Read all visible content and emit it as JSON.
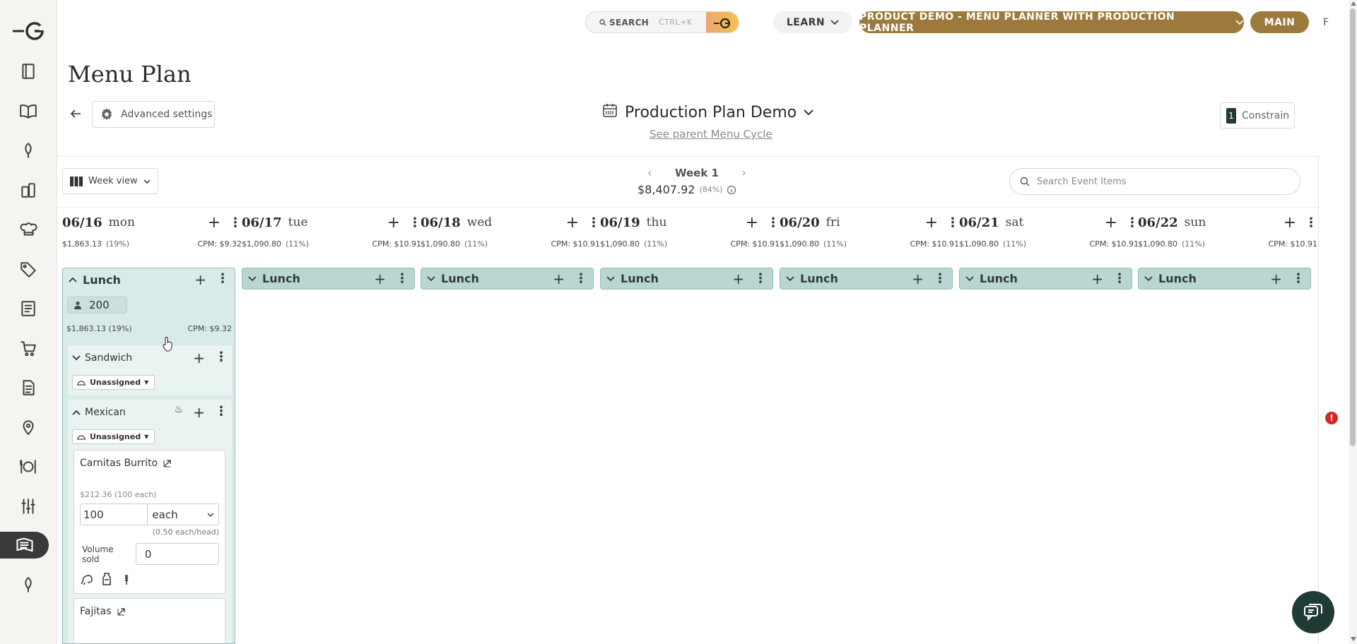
{
  "topbar": {
    "search_label": "SEARCH",
    "search_shortcut": "CTRL+K",
    "learn_label": "LEARN",
    "demo_label": "PRODUCT DEMO - MENU PLANNER WITH PRODUCTION PLANNER",
    "main_label": "MAIN",
    "user_initial": "F"
  },
  "sidebar": {
    "icons": [
      "logo-icon",
      "recipes-icon",
      "book-icon",
      "ingredient-icon",
      "products-icon",
      "chef-icon",
      "tag-icon",
      "checklist-icon",
      "cart-icon",
      "document-icon",
      "location-icon",
      "dining-icon",
      "sliders-icon",
      "menu-planner-icon",
      "leaf-icon"
    ],
    "active": "menu-planner-icon"
  },
  "page": {
    "title": "Menu Plan",
    "advanced_settings": "Advanced settings",
    "plan_name": "Production Plan Demo",
    "parent_link": "See parent Menu Cycle",
    "constrain_count": "1",
    "constrain_label": "Constrain"
  },
  "week": {
    "view_label": "Week view",
    "label": "Week 1",
    "cost": "$8,407.92",
    "cost_pct": "(84%)",
    "search_placeholder": "Search Event Items"
  },
  "days": [
    {
      "date": "06/16",
      "name": "mon",
      "cost": "$1,863.13",
      "pct": "(19%)",
      "cpm": "CPM: $9.32"
    },
    {
      "date": "06/17",
      "name": "tue",
      "cost": "$1,090.80",
      "pct": "(11%)",
      "cpm": "CPM: $10.91"
    },
    {
      "date": "06/18",
      "name": "wed",
      "cost": "$1,090.80",
      "pct": "(11%)",
      "cpm": "CPM: $10.91"
    },
    {
      "date": "06/19",
      "name": "thu",
      "cost": "$1,090.80",
      "pct": "(11%)",
      "cpm": "CPM: $10.91"
    },
    {
      "date": "06/20",
      "name": "fri",
      "cost": "$1,090.80",
      "pct": "(11%)",
      "cpm": "CPM: $10.91"
    },
    {
      "date": "06/21",
      "name": "sat",
      "cost": "$1,090.80",
      "pct": "(11%)",
      "cpm": "CPM: $10.91"
    },
    {
      "date": "06/22",
      "name": "sun",
      "cost": "$1,090.80",
      "pct": "(11%)",
      "cpm": "CPM: $10.91"
    }
  ],
  "meal_label": "Lunch",
  "lunch_mon": {
    "guests": "200",
    "cost": "$1,863.13",
    "pct": "(19%)",
    "cpm": "CPM:  $9.32",
    "sections": [
      {
        "name": "Sandwich",
        "assign": "Unassigned"
      },
      {
        "name": "Mexican",
        "assign": "Unassigned"
      }
    ],
    "items": [
      {
        "name": "Carnitas Burrito",
        "price": "$212.36 (100 each)",
        "qty": "100",
        "unit": "each",
        "per_head": "(0.50 each/head)",
        "volume_label": "Volume sold",
        "volume": "0"
      },
      {
        "name": "Fajitas"
      }
    ]
  },
  "alert_count": "!"
}
